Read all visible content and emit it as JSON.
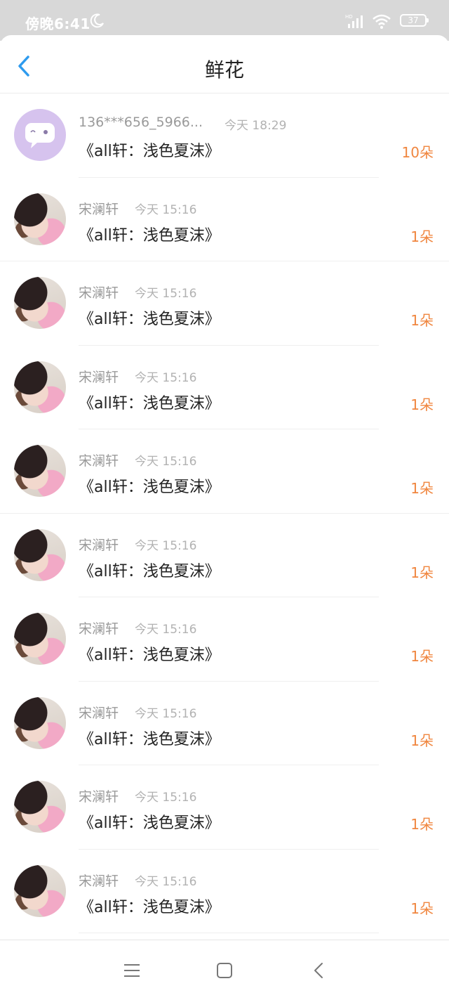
{
  "status_bar": {
    "time": "傍晚6:41",
    "battery": "37",
    "icons": [
      "moon-icon",
      "signal-icon",
      "wifi-icon",
      "battery-icon"
    ]
  },
  "header": {
    "title": "鲜花",
    "back_icon": "chevron-left-icon"
  },
  "colors": {
    "accent_blue": "#2e9bee",
    "count_orange": "#f0863f",
    "status_bar_bg": "#d8d8d8",
    "avatar_system_bg": "#d6c3ee"
  },
  "items": [
    {
      "name": "136***656_5966...",
      "time": "今天 18:29",
      "title": "《all轩：浅色夏沫》",
      "count": "10朵",
      "avatar": "system"
    },
    {
      "name": "宋澜轩",
      "time": "今天 15:16",
      "title": "《all轩：浅色夏沫》",
      "count": "1朵",
      "avatar": "photo"
    },
    {
      "name": "宋澜轩",
      "time": "今天 15:16",
      "title": "《all轩：浅色夏沫》",
      "count": "1朵",
      "avatar": "photo"
    },
    {
      "name": "宋澜轩",
      "time": "今天 15:16",
      "title": "《all轩：浅色夏沫》",
      "count": "1朵",
      "avatar": "photo"
    },
    {
      "name": "宋澜轩",
      "time": "今天 15:16",
      "title": "《all轩：浅色夏沫》",
      "count": "1朵",
      "avatar": "photo"
    },
    {
      "name": "宋澜轩",
      "time": "今天 15:16",
      "title": "《all轩：浅色夏沫》",
      "count": "1朵",
      "avatar": "photo"
    },
    {
      "name": "宋澜轩",
      "time": "今天 15:16",
      "title": "《all轩：浅色夏沫》",
      "count": "1朵",
      "avatar": "photo"
    },
    {
      "name": "宋澜轩",
      "time": "今天 15:16",
      "title": "《all轩：浅色夏沫》",
      "count": "1朵",
      "avatar": "photo"
    },
    {
      "name": "宋澜轩",
      "time": "今天 15:16",
      "title": "《all轩：浅色夏沫》",
      "count": "1朵",
      "avatar": "photo"
    },
    {
      "name": "宋澜轩",
      "time": "今天 15:16",
      "title": "《all轩：浅色夏沫》",
      "count": "1朵",
      "avatar": "photo"
    }
  ],
  "nav_bar": {
    "icons": [
      "menu-icon",
      "home-square-icon",
      "back-triangle-icon"
    ]
  }
}
